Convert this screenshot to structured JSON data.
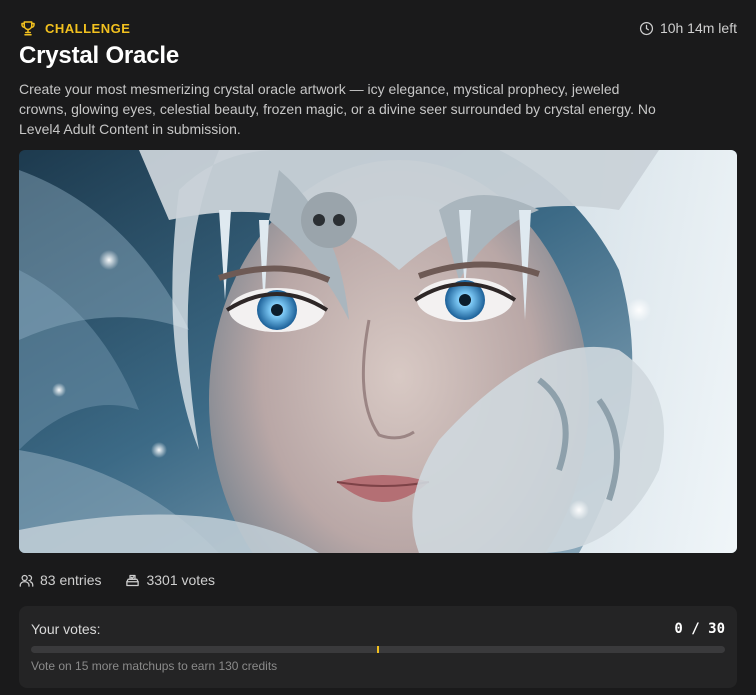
{
  "challenge": {
    "badge": "CHALLENGE",
    "badge_icon": "trophy-icon",
    "time_left": "10h 14m left",
    "time_icon": "clock-icon",
    "title": "Crystal Oracle",
    "description": "Create your most mesmerizing crystal oracle artwork — icy elegance, mystical prophecy, jeweled crowns, glowing eyes, celestial beauty, frozen magic, or a divine seer surrounded by crystal energy. No Level4 Adult Content in submission."
  },
  "stats": {
    "entries": "83 entries",
    "entries_icon": "users-icon",
    "votes": "3301 votes",
    "votes_icon": "ballot-box-icon"
  },
  "voting": {
    "label": "Your votes:",
    "count": "0 / 30",
    "votes_cast": 0,
    "votes_total": 30,
    "milestone_votes": 15,
    "hint": "Vote on 15 more matchups to earn 130 credits"
  },
  "colors": {
    "accent": "#f2c11f",
    "background": "#1a1a1b",
    "panel": "#242425"
  }
}
